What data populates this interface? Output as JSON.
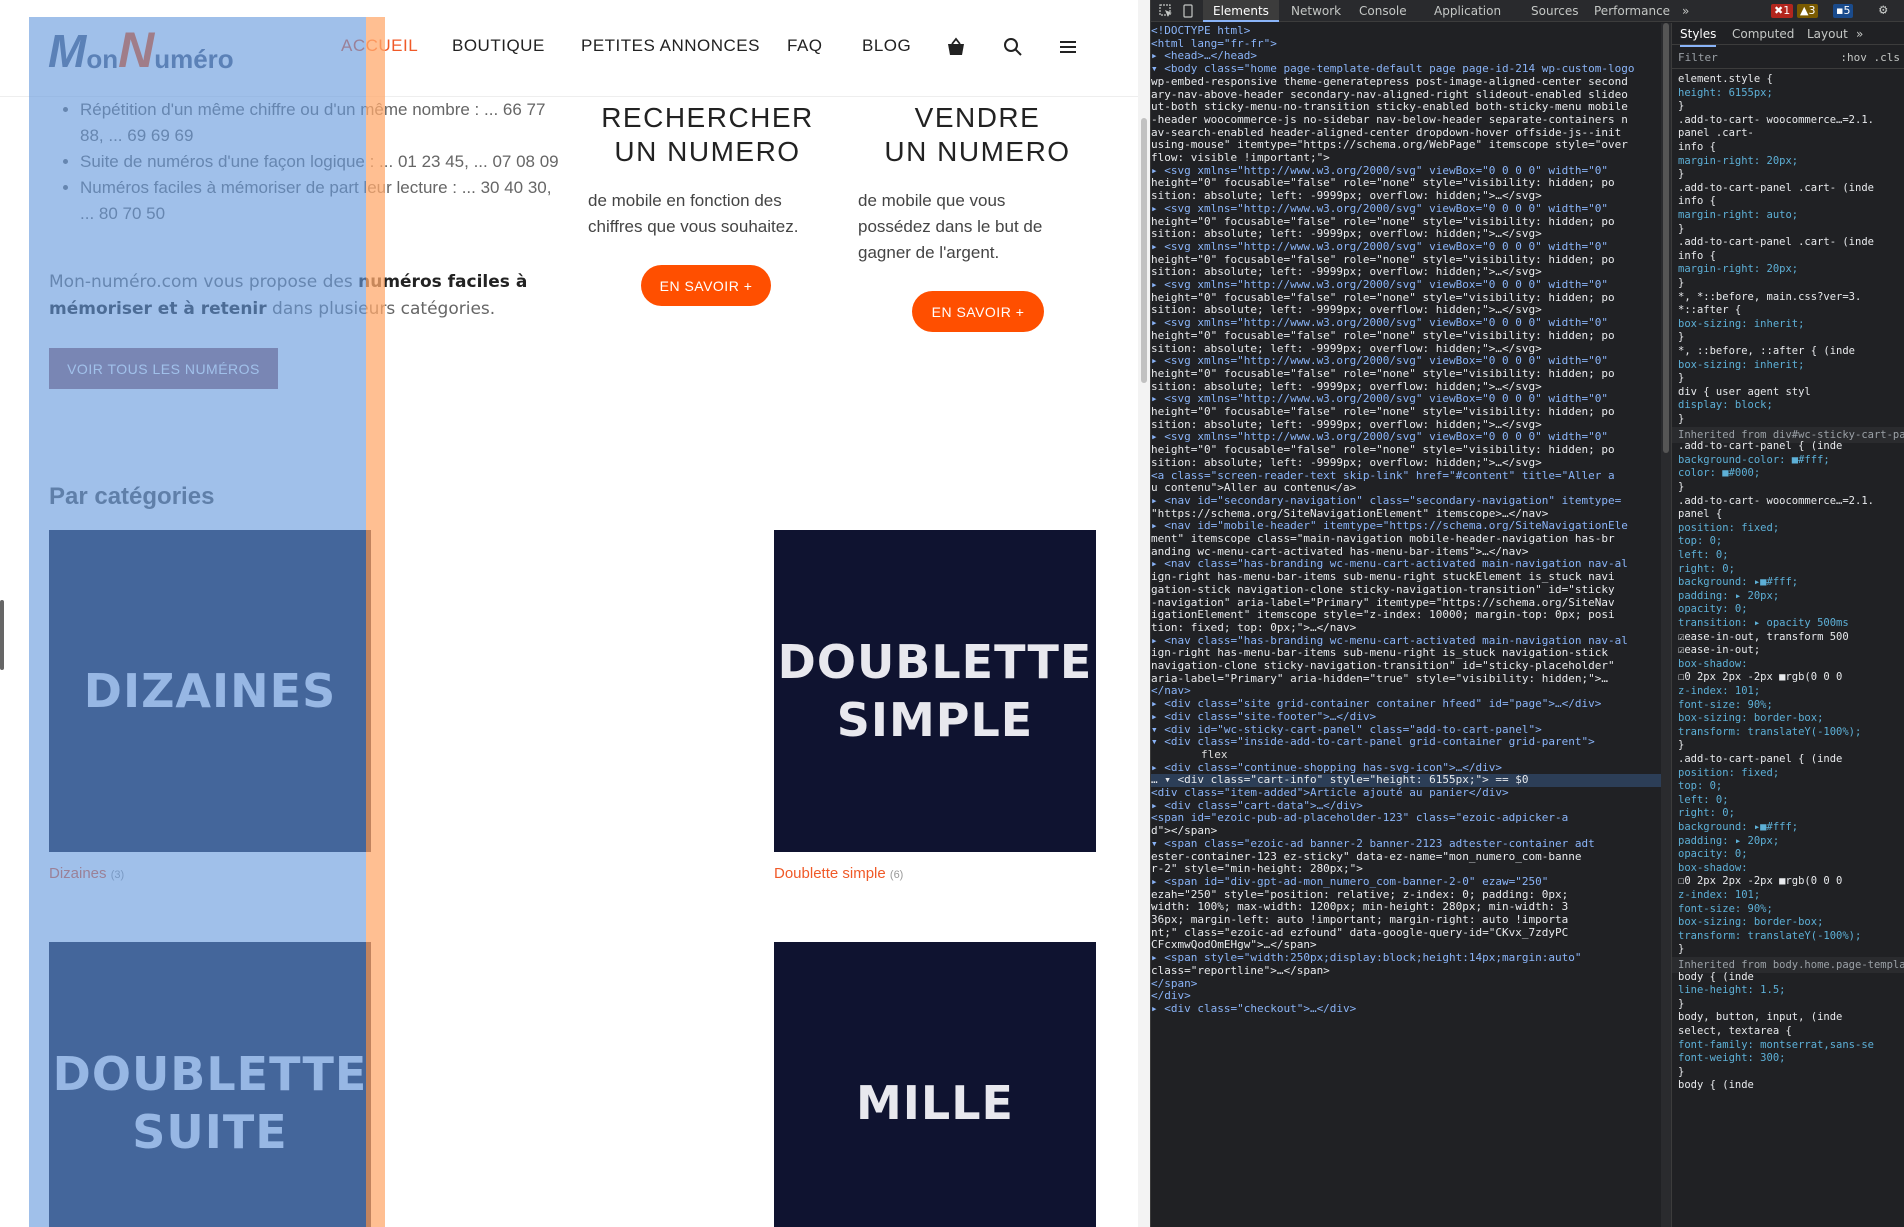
{
  "site": {
    "logo": {
      "part1": "M",
      "part2": "on",
      "part3": "N",
      "part4": "uméro"
    },
    "nav": [
      {
        "label": "ACCUEIL",
        "active": true
      },
      {
        "label": "BOUTIQUE",
        "active": false
      },
      {
        "label": "PETITES ANNONCES",
        "active": false
      },
      {
        "label": "FAQ",
        "active": false
      },
      {
        "label": "BLOG",
        "active": false
      }
    ],
    "nav_icons": [
      "basket-icon",
      "search-icon",
      "menu-icon"
    ],
    "bullets": [
      "Répétition d'un même chiffre ou d'un même nombre : ... 66 77 88, ... 69 69 69",
      "Suite de numéros d'une façon logique : ... 01 23 45, ... 07 08 09",
      "Numéros faciles à mémoriser de part leur lecture : ... 30 40 30, ... 80 70 50"
    ],
    "intro": {
      "pre": "Mon-numéro.com vous propose des ",
      "bold": "numéros faciles à mémoriser et à retenir",
      "post": " dans plusieurs catégories."
    },
    "all_numbers_button": "VOIR TOUS LES NUMÉROS",
    "features": [
      {
        "title_line1": "RECHERCHER",
        "title_line2": "UN NUMERO",
        "desc": "de mobile en fonction des chiffres que vous souhaitez.",
        "button": "EN SAVOIR +"
      },
      {
        "title_line1": "VENDRE",
        "title_line2": "UN NUMERO",
        "desc": "de mobile que vous possédez dans le but de gagner de l'argent.",
        "button": "EN SAVOIR +"
      }
    ],
    "categories_title": "Par catégories",
    "categories": [
      {
        "tile_line1": "DIZAINES",
        "tile_line2": "",
        "caption": "Dizaines",
        "count": "(3)"
      },
      {
        "tile_line1": "DOUBLETTE",
        "tile_line2": "SIMPLE",
        "caption": "Doublette simple",
        "count": "(6)"
      },
      {
        "tile_line1": "DOUBLETTE",
        "tile_line2": "SUITE",
        "caption": "",
        "count": ""
      },
      {
        "tile_line1": "MILLE",
        "tile_line2": "",
        "caption": "",
        "count": ""
      }
    ],
    "colors": {
      "accent": "#ff4f00",
      "tile": "#0f1330",
      "overlay_blue": "#6699dd",
      "overlay_orange": "#ffaa6e"
    }
  },
  "devtools": {
    "tabs": [
      "Elements",
      "Network",
      "Console",
      "Application",
      "Sources",
      "Performance",
      "»"
    ],
    "badges": {
      "errors": "1",
      "warnings": "3",
      "messages": "5"
    },
    "dom_lines": [
      "<!DOCTYPE html>",
      "<html lang=\"fr-fr\">",
      "▸ <head>…</head>",
      "▾ <body class=\"home page-template-default page page-id-214 wp-custom-logo",
      "   wp-embed-responsive theme-generatepress post-image-aligned-center second",
      "   ary-nav-above-header secondary-nav-aligned-right slideout-enabled slideo",
      "   ut-both sticky-menu-no-transition sticky-enabled both-sticky-menu mobile",
      "   -header woocommerce-js no-sidebar nav-below-header separate-containers n",
      "   av-search-enabled header-aligned-center dropdown-hover offside-js--init",
      "   using-mouse\" itemtype=\"https://schema.org/WebPage\" itemscope style=\"over",
      "   flow: visible !important;\">",
      "  ▸ <svg xmlns=\"http://www.w3.org/2000/svg\" viewBox=\"0 0 0 0\" width=\"0\"",
      "     height=\"0\" focusable=\"false\" role=\"none\" style=\"visibility: hidden; po",
      "     sition: absolute; left: -9999px; overflow: hidden;\">…</svg>",
      "  ▸ <svg xmlns=\"http://www.w3.org/2000/svg\" viewBox=\"0 0 0 0\" width=\"0\"",
      "     height=\"0\" focusable=\"false\" role=\"none\" style=\"visibility: hidden; po",
      "     sition: absolute; left: -9999px; overflow: hidden;\">…</svg>",
      "  ▸ <svg xmlns=\"http://www.w3.org/2000/svg\" viewBox=\"0 0 0 0\" width=\"0\"",
      "     height=\"0\" focusable=\"false\" role=\"none\" style=\"visibility: hidden; po",
      "     sition: absolute; left: -9999px; overflow: hidden;\">…</svg>",
      "  ▸ <svg xmlns=\"http://www.w3.org/2000/svg\" viewBox=\"0 0 0 0\" width=\"0\"",
      "     height=\"0\" focusable=\"false\" role=\"none\" style=\"visibility: hidden; po",
      "     sition: absolute; left: -9999px; overflow: hidden;\">…</svg>",
      "  ▸ <svg xmlns=\"http://www.w3.org/2000/svg\" viewBox=\"0 0 0 0\" width=\"0\"",
      "     height=\"0\" focusable=\"false\" role=\"none\" style=\"visibility: hidden; po",
      "     sition: absolute; left: -9999px; overflow: hidden;\">…</svg>",
      "  ▸ <svg xmlns=\"http://www.w3.org/2000/svg\" viewBox=\"0 0 0 0\" width=\"0\"",
      "     height=\"0\" focusable=\"false\" role=\"none\" style=\"visibility: hidden; po",
      "     sition: absolute; left: -9999px; overflow: hidden;\">…</svg>",
      "  ▸ <svg xmlns=\"http://www.w3.org/2000/svg\" viewBox=\"0 0 0 0\" width=\"0\"",
      "     height=\"0\" focusable=\"false\" role=\"none\" style=\"visibility: hidden; po",
      "     sition: absolute; left: -9999px; overflow: hidden;\">…</svg>",
      "  ▸ <svg xmlns=\"http://www.w3.org/2000/svg\" viewBox=\"0 0 0 0\" width=\"0\"",
      "     height=\"0\" focusable=\"false\" role=\"none\" style=\"visibility: hidden; po",
      "     sition: absolute; left: -9999px; overflow: hidden;\">…</svg>",
      "    <a class=\"screen-reader-text skip-link\" href=\"#content\" title=\"Aller a",
      "     u contenu\">Aller au contenu</a>",
      "  ▸ <nav id=\"secondary-navigation\" class=\"secondary-navigation\" itemtype=",
      "     \"https://schema.org/SiteNavigationElement\" itemscope>…</nav>",
      "  ▸ <nav id=\"mobile-header\" itemtype=\"https://schema.org/SiteNavigationEle",
      "     ment\" itemscope class=\"main-navigation mobile-header-navigation has-br",
      "     anding wc-menu-cart-activated has-menu-bar-items\">…</nav>",
      "  ▸ <nav class=\"has-branding wc-menu-cart-activated main-navigation nav-al",
      "     ign-right has-menu-bar-items sub-menu-right stuckElement is_stuck navi",
      "     gation-stick navigation-clone sticky-navigation-transition\" id=\"sticky",
      "     -navigation\" aria-label=\"Primary\" itemtype=\"https://schema.org/SiteNav",
      "     igationElement\" itemscope style=\"z-index: 10000; margin-top: 0px; posi",
      "     tion: fixed; top: 0px;\">…</nav>",
      "  ▸ <nav class=\"has-branding wc-menu-cart-activated main-navigation nav-al",
      "     ign-right has-menu-bar-items sub-menu-right is_stuck navigation-stick",
      "     navigation-clone sticky-navigation-transition\" id=\"sticky-placeholder\"",
      "     aria-label=\"Primary\" aria-hidden=\"true\" style=\"visibility: hidden;\">…",
      "     </nav>",
      "  ▸ <div class=\"site grid-container container hfeed\" id=\"page\">…</div>",
      "  ▸ <div class=\"site-footer\">…</div>",
      "  ▾ <div id=\"wc-sticky-cart-panel\" class=\"add-to-cart-panel\">",
      "    ▾ <div class=\"inside-add-to-cart-panel grid-container grid-parent\">",
      "       flex",
      "      ▸ <div class=\"continue-shopping has-svg-icon\">…</div>",
      "…     ▾ <div class=\"cart-info\" style=\"height: 6155px;\"> == $0",
      "          <div class=\"item-added\">Article ajouté au panier</div>",
      "        ▸ <div class=\"cart-data\">…</div>",
      "          <span id=\"ezoic-pub-ad-placeholder-123\" class=\"ezoic-adpicker-a",
      "          d\"></span>",
      "        ▾ <span class=\"ezoic-ad banner-2 banner-2123 adtester-container adt",
      "          ester-container-123 ez-sticky\" data-ez-name=\"mon_numero_com-banne",
      "          r-2\" style=\"min-height: 280px;\">",
      "          ▸ <span id=\"div-gpt-ad-mon_numero_com-banner-2-0\" ezaw=\"250\"",
      "            ezah=\"250\" style=\"position: relative; z-index: 0; padding: 0px;",
      "            width: 100%; max-width: 1200px; min-height: 280px; min-width: 3",
      "            36px; margin-left: auto !important; margin-right: auto !importa",
      "            nt;\" class=\"ezoic-ad ezfound\" data-google-query-id=\"CKvx_7zdyPC",
      "            CFcxmwQodOmEHgw\">…</span>",
      "          ▸ <span style=\"width:250px;display:block;height:14px;margin:auto\"",
      "            class=\"reportline\">…</span>",
      "          </span>",
      "        </div>",
      "      ▸ <div class=\"checkout\">…</div>"
    ],
    "styles_tabs": [
      "Styles",
      "Computed",
      "Layout",
      "»"
    ],
    "styles_filter": "Filter",
    "styles_hov": ":hov  .cls",
    "style_lines": [
      "element.style {",
      "  height: 6155px;",
      "}",
      ".add-to-cart-    woocommerce…=2.1.",
      "panel .cart-",
      "info {",
      "  margin-right: 20px;",
      "}",
      ".add-to-cart-panel .cart-    (inde",
      "info {",
      "  margin-right: auto;",
      "}",
      ".add-to-cart-panel .cart-    (inde",
      "info {",
      "  margin-right: 20px;",
      "}",
      "*, *::before,         main.css?ver=3.",
      "*::after {",
      "  box-sizing: inherit;",
      "}",
      "*, ::before, ::after {      (inde",
      "  box-sizing: inherit;",
      "}",
      "div {          user agent styl",
      "  display: block;",
      "}",
      "Inherited from div#wc-sticky-cart-pan",
      ".add-to-cart-panel {        (inde",
      "  background-color: ■#fff;",
      "  color: ■#000;",
      "}",
      ".add-to-cart-    woocommerce…=2.1.",
      "panel {",
      "  position: fixed;",
      "  top: 0;",
      "  left: 0;",
      "  right: 0;",
      "  background: ▸■#fff;",
      "  padding: ▸ 20px;",
      "  opacity: 0;",
      "  transition: ▸ opacity 500ms",
      "      ☑ease-in-out, transform 500",
      "      ☑ease-in-out;",
      "  box-shadow:",
      "      ☐0 2px 2px -2px ■rgb(0 0 0",
      "  z-index: 101;",
      "  font-size: 90%;",
      "  box-sizing: border-box;",
      "  transform: translateY(-100%);",
      "}",
      ".add-to-cart-panel {        (inde",
      "  position: fixed;",
      "  top: 0;",
      "  left: 0;",
      "  right: 0;",
      "  background: ▸■#fff;",
      "  padding: ▸ 20px;",
      "  opacity: 0;",
      "  box-shadow:",
      "      ☐0 2px 2px -2px ■rgb(0 0 0",
      "  z-index: 101;",
      "  font-size: 90%;",
      "  box-sizing: border-box;",
      "  transform: translateY(-100%);",
      "}",
      "Inherited from body.home.page-templat",
      "body {                      (inde",
      "  line-height: 1.5;",
      "}",
      "body, button, input,        (inde",
      "select, textarea {",
      "  font-family: montserrat,sans-se",
      "  font-weight: 300;",
      "}",
      "body {                      (inde"
    ]
  }
}
